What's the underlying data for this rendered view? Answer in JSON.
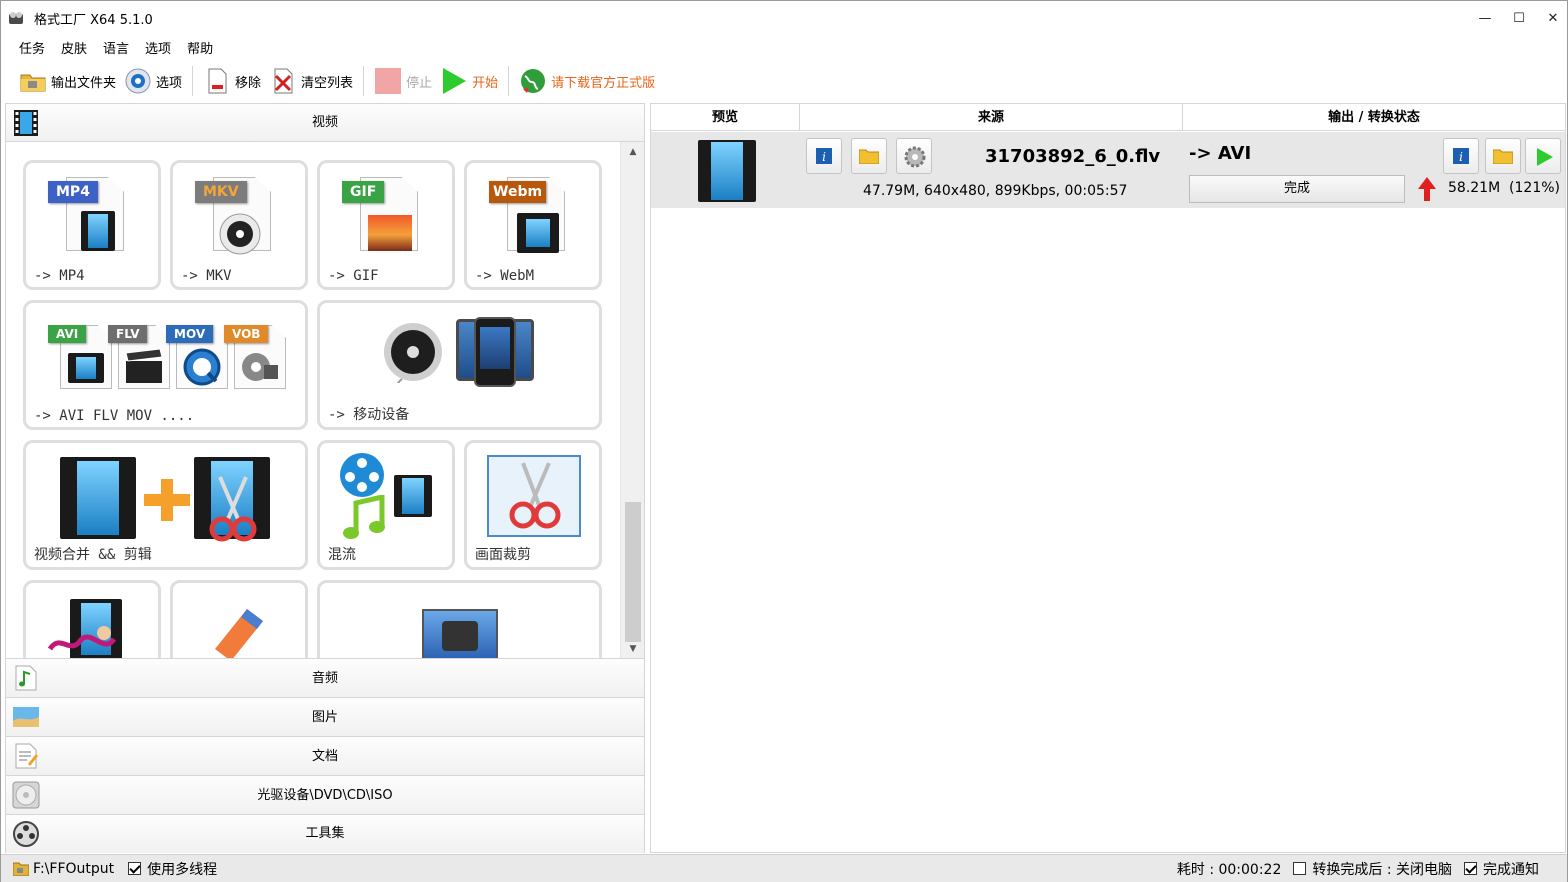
{
  "window": {
    "title": "格式工厂 X64 5.1.0",
    "minimize": "—",
    "maximize": "☐",
    "close": "✕"
  },
  "menu": [
    "任务",
    "皮肤",
    "语言",
    "选项",
    "帮助"
  ],
  "toolbar": {
    "output_folder": "输出文件夹",
    "options": "选项",
    "remove": "移除",
    "clear_list": "清空列表",
    "stop": "停止",
    "start": "开始",
    "download": "请下载官方正式版",
    "colors": {
      "download": "#e8651a"
    }
  },
  "categories": {
    "video": "视频",
    "audio": "音频",
    "picture": "图片",
    "document": "文档",
    "disc": "光驱设备\\DVD\\CD\\ISO",
    "tools": "工具集"
  },
  "video_tiles": {
    "mp4": {
      "badge": "MP4",
      "label": "-> MP4"
    },
    "mkv": {
      "badge": "MKV",
      "label": "-> MKV"
    },
    "gif": {
      "badge": "GIF",
      "label": "-> GIF"
    },
    "webm": {
      "badge": "Webm",
      "label": "-> WebM"
    },
    "multi": {
      "badges": [
        "AVI",
        "FLV",
        "MOV",
        "VOB"
      ],
      "label": "-> AVI FLV MOV ...."
    },
    "mobile": {
      "label": "-> 移动设备"
    },
    "join": {
      "label": "视频合并 && 剪辑"
    },
    "mux": {
      "label": "混流"
    },
    "crop": {
      "label": "画面裁剪"
    }
  },
  "task_list": {
    "headers": {
      "preview": "预览",
      "source": "来源",
      "output": "输出 / 转换状态"
    },
    "task": {
      "filename": "31703892_6_0.flv",
      "info": "47.79M, 640x480, 899Kbps, 00:05:57",
      "target": "-> AVI",
      "status": "完成",
      "result": "58.21M  (121%)"
    }
  },
  "statusbar": {
    "output_path": "F:\\FFOutput",
    "multithread": "使用多线程",
    "multithread_checked": true,
    "elapsed": "耗时 : 00:00:22",
    "after_done": "转换完成后 : 关闭电脑",
    "after_done_checked": false,
    "notify": "完成通知",
    "notify_checked": true
  }
}
